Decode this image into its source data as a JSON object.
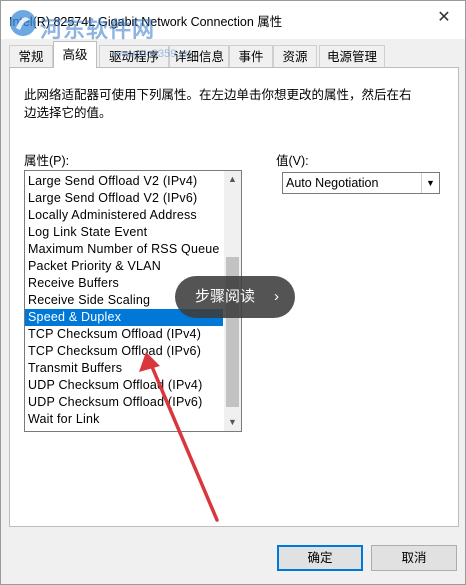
{
  "window": {
    "title": "Intel(R) 82574L Gigabit Network Connection 属性",
    "close_glyph": "✕"
  },
  "tabs": [
    {
      "label": "常规",
      "active": false
    },
    {
      "label": "高级",
      "active": true
    },
    {
      "label": "驱动程序",
      "active": false
    },
    {
      "label": "详细信息",
      "active": false
    },
    {
      "label": "事件",
      "active": false
    },
    {
      "label": "资源",
      "active": false
    },
    {
      "label": "电源管理",
      "active": false
    }
  ],
  "panel": {
    "description": "此网络适配器可使用下列属性。在左边单击你想更改的属性，然后在右边选择它的值。",
    "property_label": "属性(P):",
    "value_label": "值(V):",
    "properties": [
      "Large Send Offload V2 (IPv4)",
      "Large Send Offload V2 (IPv6)",
      "Locally Administered Address",
      "Log Link State Event",
      "Maximum Number of RSS Queue",
      "Packet Priority & VLAN",
      "Receive Buffers",
      "Receive Side Scaling",
      "Speed & Duplex",
      "TCP Checksum Offload (IPv4)",
      "TCP Checksum Offload (IPv6)",
      "Transmit Buffers",
      "UDP Checksum Offload (IPv4)",
      "UDP Checksum Offload (IPv6)",
      "Wait for Link"
    ],
    "selected_property": "Speed & Duplex",
    "value_selected": "Auto Negotiation"
  },
  "buttons": {
    "ok": "确定",
    "cancel": "取消"
  },
  "overlay": {
    "label": "步骤阅读",
    "chevron": "›"
  },
  "watermark": {
    "text": "河东软件网",
    "url": "www.pc0359.cn"
  },
  "colors": {
    "selection": "#0078d7",
    "arrow": "#d9363e",
    "watermark": "#3278c8"
  },
  "icons": [
    "close-icon",
    "scroll-up-icon",
    "scroll-down-icon",
    "dropdown-arrow-icon",
    "chevron-right-icon",
    "watermark-logo-icon"
  ]
}
